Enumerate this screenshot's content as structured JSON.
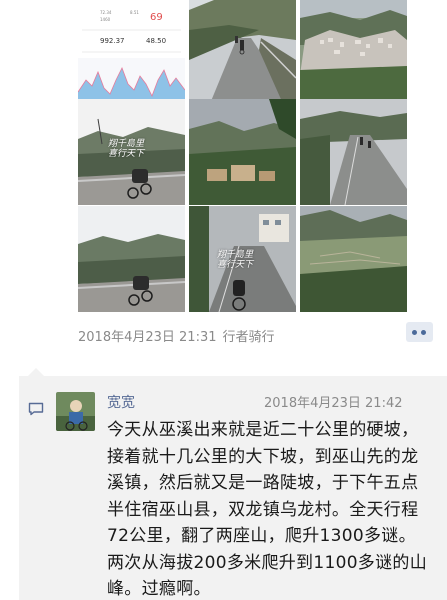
{
  "moment": {
    "photos": [
      {
        "name": "photo-cycling-stats",
        "caption": "",
        "stats": {
          "duration": "72.34",
          "calories": "8.51",
          "speed": "1460",
          "heart_rate": "69",
          "climb": "992.37",
          "distance": "48.50"
        }
      },
      {
        "name": "photo-road-cyclists-1",
        "caption": ""
      },
      {
        "name": "photo-valley-town",
        "caption": ""
      },
      {
        "name": "photo-bike-mountain-1",
        "caption": "翔千島里 喜行天下"
      },
      {
        "name": "photo-mountain-village",
        "caption": ""
      },
      {
        "name": "photo-road-cyclists-2",
        "caption": ""
      },
      {
        "name": "photo-bike-mountain-2",
        "caption": ""
      },
      {
        "name": "photo-bike-road-closeup",
        "caption": "翔千島里 喜行天下"
      },
      {
        "name": "photo-terraced-valley",
        "caption": ""
      }
    ],
    "timestamp": "2018年4月23日 21:31",
    "author_label": "行者骑行"
  },
  "comment": {
    "icon": "comment-icon",
    "name": "宽宽",
    "time": "2018年4月23日 21:42",
    "text": "今天从巫溪出来就是近二十公里的硬坡，接着就十几公里的大下坡，到巫山先的龙溪镇，然后就又是一路陡坡，于下午五点半住宿巫山县，双龙镇乌龙村。全天行程72公里，翻了两座山，爬升1300多谜。两次从海拔200多米爬升到1100多谜的山峰。过瘾啊。"
  },
  "colors": {
    "link": "#576b95",
    "meta": "#8a8a8a",
    "comment_bg": "#f2f2f2"
  }
}
